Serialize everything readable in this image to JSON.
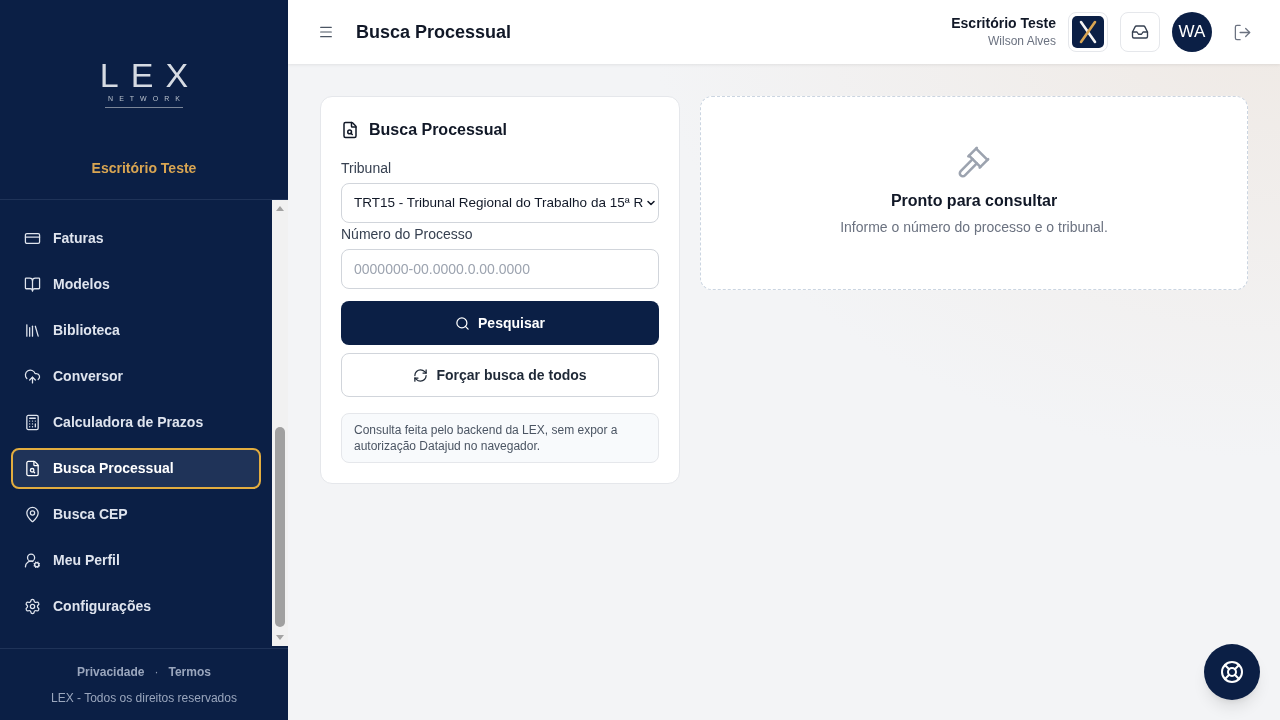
{
  "sidebar": {
    "logo": {
      "wordmark": "LEX",
      "subtitle": "NETWORK"
    },
    "office": "Escritório Teste",
    "items": [
      {
        "label": "Faturas",
        "selected": false
      },
      {
        "label": "Modelos",
        "selected": false
      },
      {
        "label": "Biblioteca",
        "selected": false
      },
      {
        "label": "Conversor",
        "selected": false
      },
      {
        "label": "Calculadora de Prazos",
        "selected": false
      },
      {
        "label": "Busca Processual",
        "selected": true
      },
      {
        "label": "Busca CEP",
        "selected": false
      },
      {
        "label": "Meu Perfil",
        "selected": false
      },
      {
        "label": "Configurações",
        "selected": false
      }
    ],
    "footer": {
      "links": [
        "Privacidade",
        "Termos"
      ],
      "separator": "·",
      "copyright": "LEX - Todos os direitos reservados"
    }
  },
  "header": {
    "title": "Busca Processual",
    "office": "Escritório Teste",
    "user": "Wilson Alves",
    "initials": "WA"
  },
  "search_card": {
    "title": "Busca Processual",
    "tribunal": {
      "label": "Tribunal",
      "value": "TRT15 - Tribunal Regional do Trabalho da 15ª R"
    },
    "process_number": {
      "label": "Número do Processo",
      "placeholder": "0000000-00.0000.0.00.0000"
    },
    "buttons": [
      {
        "kind": "primary",
        "label": "Pesquisar"
      },
      {
        "kind": "secondary",
        "label": "Forçar busca de todos"
      }
    ],
    "note": "Consulta feita pelo backend da LEX, sem expor a autorização Datajud no navegador."
  },
  "result_panel": {
    "title": "Pronto para consultar",
    "message": "Informe o número do processo e o tribunal."
  }
}
